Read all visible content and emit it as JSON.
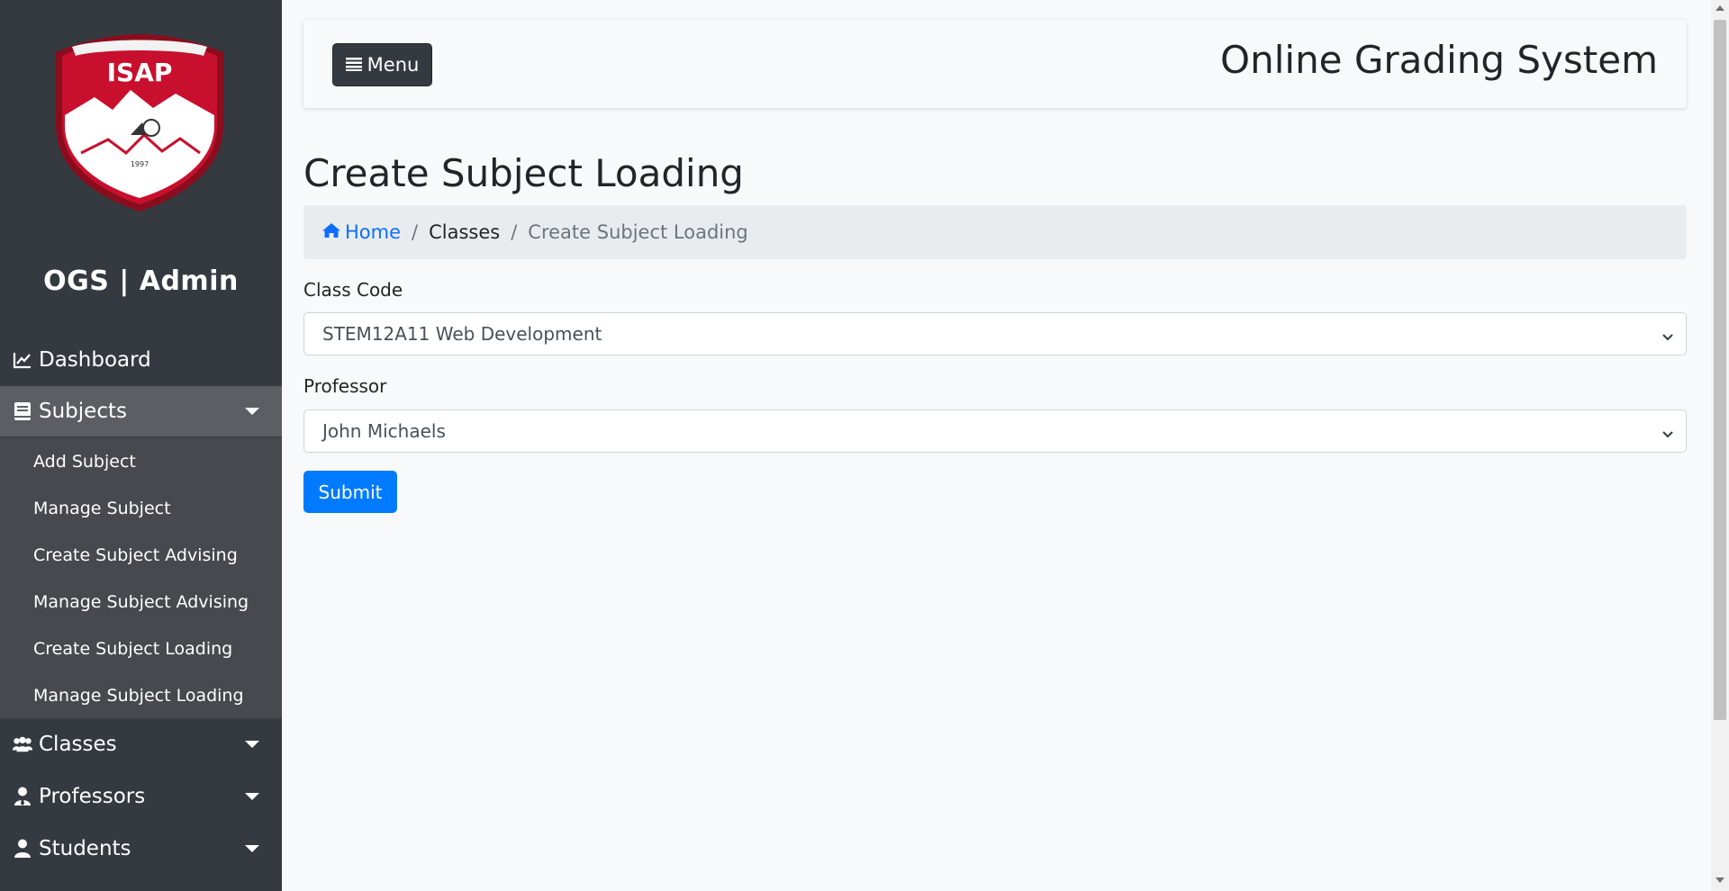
{
  "sidebar": {
    "logo_text": "ISAP",
    "logo_year": "1997",
    "brand": "OGS | Admin",
    "items": [
      {
        "label": "Dashboard",
        "icon": "chart-line-icon"
      },
      {
        "label": "Subjects",
        "icon": "book-icon",
        "expanded": true
      },
      {
        "label": "Classes",
        "icon": "users-icon"
      },
      {
        "label": "Professors",
        "icon": "user-tie-icon"
      },
      {
        "label": "Students",
        "icon": "user-icon"
      }
    ],
    "subjects_submenu": [
      "Add Subject",
      "Manage Subject",
      "Create Subject Advising",
      "Manage Subject Advising",
      "Create Subject Loading",
      "Manage Subject Loading"
    ]
  },
  "header": {
    "menu_label": "Menu",
    "app_title": "Online Grading System"
  },
  "page": {
    "title": "Create Subject Loading",
    "breadcrumb": {
      "home": "Home",
      "classes": "Classes",
      "current": "Create Subject Loading"
    }
  },
  "form": {
    "class_code_label": "Class Code",
    "class_code_value": "STEM12A11 Web Development",
    "professor_label": "Professor",
    "professor_value": "John Michaels",
    "submit_label": "Submit"
  },
  "colors": {
    "sidebar_bg": "#343a40",
    "sidebar_active": "#5b5f63",
    "submenu_bg": "#46494d",
    "primary": "#007bff",
    "logo_red": "#c8102e"
  }
}
